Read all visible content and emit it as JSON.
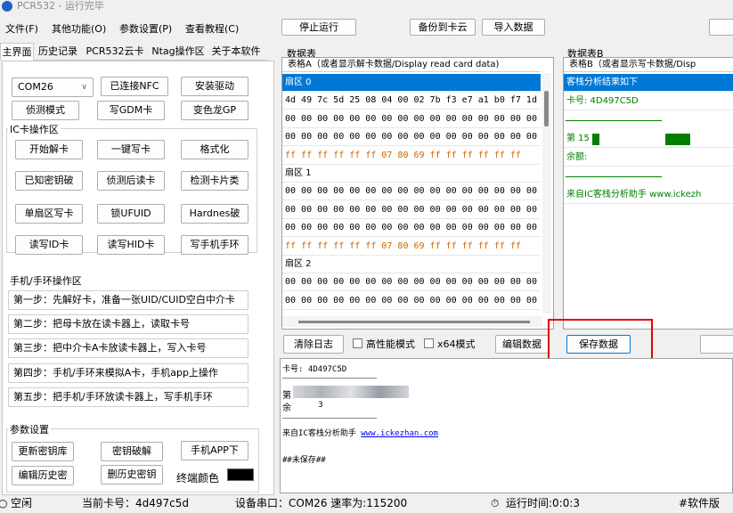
{
  "app": {
    "title": "PCR532 - 运行完毕"
  },
  "menu": [
    "文件(F)",
    "其他功能(O)",
    "参数设置(P)",
    "查看教程(C)"
  ],
  "toolbar": {
    "stop": "停止运行",
    "backup": "备份到卡云",
    "import": "导入数据"
  },
  "tabs": [
    "主界面",
    "历史记录",
    "PCR532云卡",
    "Ntag操作区",
    "关于本软件"
  ],
  "left": {
    "com_select": "COM26",
    "btn_connected": "已连接NFC",
    "btn_driver": "安装驱动",
    "btn_detect": "侦测模式",
    "btn_gdm": "写GDM卡",
    "btn_gp": "变色龙GP",
    "ic_group": "IC卡操作区",
    "btn_decode": "开始解卡",
    "btn_onekey": "一键写卡",
    "btn_format": "格式化",
    "btn_known": "已知密钥破",
    "btn_detect_read": "侦测后读卡",
    "btn_check_type": "检测卡片类",
    "btn_sector_write": "单扇区写卡",
    "btn_lock_ufuid": "锁UFUID",
    "btn_hardnes": "Hardnes破",
    "btn_read_id": "读写ID卡",
    "btn_read_hid": "读写HID卡",
    "btn_phone_ring": "写手机手环",
    "phone_group": "手机/手环操作区",
    "steps": [
      "第一步：先解好卡，准备一张UID/CUID空白中介卡",
      "第二步：把母卡放在读卡器上，读取卡号",
      "第三步：把中介卡A卡放读卡器上，写入卡号",
      "第四步：手机/手环来模拟A卡，手机app上操作",
      "第五步：把手机/手环放读卡器上，写手机手环"
    ],
    "param_group": "参数设置",
    "btn_update_keys": "更新密钥库",
    "btn_key_crack": "密钥破解",
    "btn_phone_app": "手机APP下",
    "btn_edit_history": "编辑历史密",
    "btn_delete_history": "删历史密钥",
    "terminal_color_label": "终端颜色"
  },
  "table_a": {
    "section_label": "数据表",
    "header": "表格A（或者显示解卡数据/Display read card data)",
    "rows": [
      {
        "text": "扇区 0",
        "kind": "sector-selected"
      },
      {
        "text": "4d 49 7c 5d 25 08 04 00 02 7b f3 e7 a1 b0 f7 1d",
        "kind": "data"
      },
      {
        "text": "00 00 00 00 00 00 00 00 00 00 00 00 00 00 00 00",
        "kind": "data"
      },
      {
        "text": "00 00 00 00 00 00 00 00 00 00 00 00 00 00 00 00",
        "kind": "data"
      },
      {
        "text": "ff ff ff ff ff ff 07 80 69 ff ff ff ff ff ff",
        "kind": "trailer"
      },
      {
        "text": "扇区 1",
        "kind": "sector"
      },
      {
        "text": "00 00 00 00 00 00 00 00 00 00 00 00 00 00 00 00",
        "kind": "data"
      },
      {
        "text": "00 00 00 00 00 00 00 00 00 00 00 00 00 00 00 00",
        "kind": "data"
      },
      {
        "text": "00 00 00 00 00 00 00 00 00 00 00 00 00 00 00 00",
        "kind": "data"
      },
      {
        "text": "ff ff ff ff ff ff 07 80 69 ff ff ff ff ff ff",
        "kind": "trailer"
      },
      {
        "text": "扇区 2",
        "kind": "sector"
      },
      {
        "text": "00 00 00 00 00 00 00 00 00 00 00 00 00 00 00 00",
        "kind": "data"
      },
      {
        "text": "00 00 00 00 00 00 00 00 00 00 00 00 00 00 00 00",
        "kind": "data"
      }
    ]
  },
  "table_b": {
    "section_label": "数据表B",
    "header": "表格B（或者显示写卡数据/Disp",
    "rows": [
      {
        "text": "客栈分析结果如下",
        "kind": "selected"
      },
      {
        "text": "卡号: 4D497C5D",
        "kind": "green"
      },
      {
        "text": "",
        "kind": "line"
      },
      {
        "text": "第 15",
        "kind": "green-bars"
      },
      {
        "text": "余额:",
        "kind": "green"
      },
      {
        "text": "",
        "kind": "line"
      },
      {
        "text": "来自IC客栈分析助手 www.ickezh",
        "kind": "green"
      }
    ]
  },
  "controls": {
    "clear_log": "清除日志",
    "high_perf": "高性能模式",
    "x64": "x64模式",
    "edit_data": "编辑数据",
    "save_data": "保存数据"
  },
  "log": {
    "card_no": "卡号: 4D497C5D",
    "line2": "第",
    "line3": "余",
    "line3_tail": "3",
    "source": "来自IC客栈分析助手",
    "link": "www.ickezhan.com",
    "unsaved": "##未保存##"
  },
  "status": {
    "idle": "空闲",
    "current_card": "当前卡号：4d497c5d",
    "port": "设备串口：COM26 速率为:115200",
    "runtime": "运行时间:0:0:3",
    "version": "#软件版"
  },
  "colors": {
    "selected": "#0078d7",
    "trailer": "#cc6600",
    "green": "#008000",
    "highlight": "#e00000"
  }
}
